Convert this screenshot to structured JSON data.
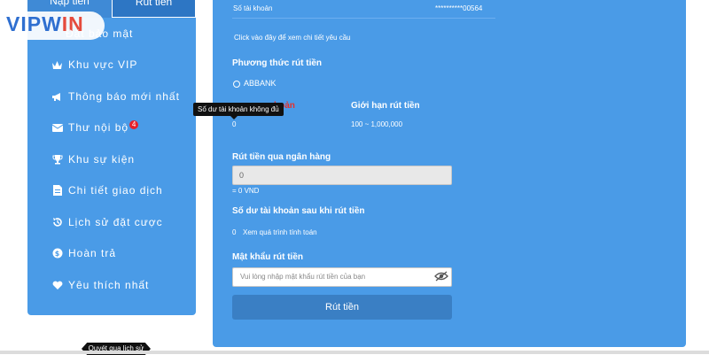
{
  "tabs": {
    "deposit": "Nạp tiền",
    "withdraw": "Rút tiền"
  },
  "logo": {
    "part_a": "VIPW",
    "part_b": "IN"
  },
  "sidebar": {
    "items": [
      {
        "label": "Đặt bảo mật",
        "icon": "lock-icon"
      },
      {
        "label": "Khu vực VIP",
        "icon": "crown-icon"
      },
      {
        "label": "Thông báo mới nhất",
        "icon": "megaphone-icon"
      },
      {
        "label": "Thư nội bộ",
        "icon": "envelope-icon",
        "badge": "4"
      },
      {
        "label": "Khu sự kiện",
        "icon": "trophy-icon"
      },
      {
        "label": "Chi tiết giao dịch",
        "icon": "document-icon"
      },
      {
        "label": "Lịch sử đặt cược",
        "icon": "history-icon"
      },
      {
        "label": "Hoàn trả",
        "icon": "dollar-icon"
      },
      {
        "label": "Yêu thích nhất",
        "icon": "heart-icon"
      }
    ]
  },
  "tooltip": "Số dư tài khoản không đủ",
  "bottom_pill": "Quyét qua lịch sử",
  "account": {
    "label": "Số tài khoản",
    "value": "**********00564"
  },
  "details_link": "Click vào đây để xem chi tiết yêu cầu",
  "method": {
    "title": "Phương thức rút tiền",
    "bank": "ABBANK"
  },
  "balance": {
    "label_fragment": "hoản",
    "value": "0"
  },
  "limit": {
    "label": "Giới hạn rút tiền",
    "value": "100 ~ 1,000,000"
  },
  "bank_transfer": {
    "label": "Rút tiền qua ngân hàng",
    "input_value": "0",
    "converted": "= 0 VND"
  },
  "after_balance": {
    "label": "Số dư tài khoản sau khi rút tiền",
    "value": "0",
    "calc_link": "Xem quá trình tính toán"
  },
  "password": {
    "label": "Mật khẩu rút tiền",
    "placeholder": "Vui lòng nhập mật khẩu rút tiền của bạn"
  },
  "submit_label": "Rút tiền",
  "colors": {
    "panel": "#4a9be7",
    "accent_dark": "#3a7fc4",
    "badge": "#e8202a",
    "warning": "#e5312c"
  }
}
